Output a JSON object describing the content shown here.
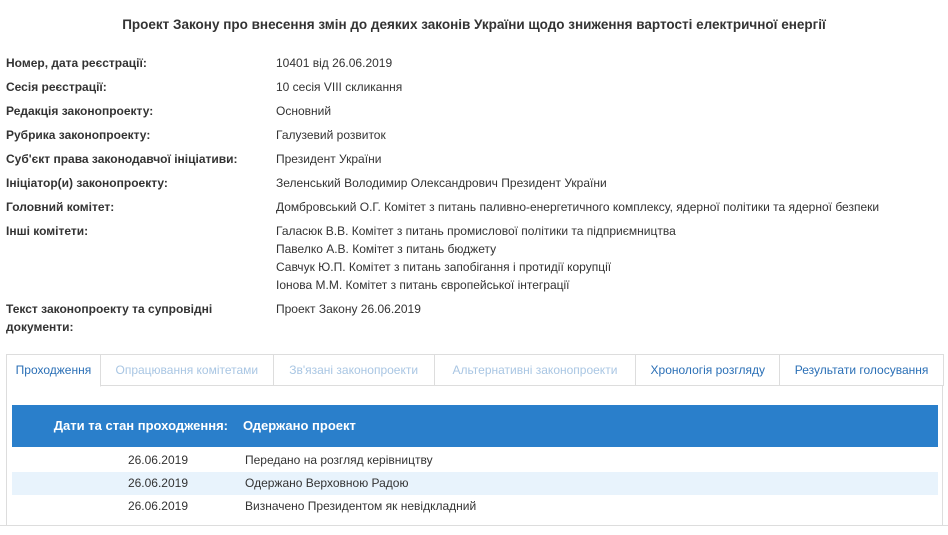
{
  "title": "Проект Закону про внесення змін до деяких законів України щодо зниження вартості електричної енергії",
  "fields": [
    {
      "label": "Номер, дата реєстрації:",
      "value": "10401 від 26.06.2019"
    },
    {
      "label": "Сесія реєстрації:",
      "value": "10 сесія VIII скликання"
    },
    {
      "label": "Редакція законопроекту:",
      "value": "Основний"
    },
    {
      "label": "Рубрика законопроекту:",
      "value": "Галузевий розвиток"
    },
    {
      "label": "Суб'єкт права законодавчої ініціативи:",
      "value": "Президент України"
    },
    {
      "label": "Ініціатор(и) законопроекту:",
      "value": "Зеленський Володимир Олександрович Президент України"
    },
    {
      "label": "Головний комітет:",
      "value": "Домбровський О.Г. Комітет з питань паливно-енергетичного комплексу, ядерної політики та ядерної безпеки"
    },
    {
      "label": "Інші комітети:",
      "values": [
        "Галасюк В.В. Комітет з питань промислової політики та підприємництва",
        "Павелко А.В. Комітет з питань бюджету",
        "Савчук Ю.П. Комітет з питань запобігання і протидії корупції",
        "Іонова М.М. Комітет з питань європейської інтеграції"
      ]
    },
    {
      "label_line1": "Текст законопроекту та супровідні",
      "label_line2": "документи:",
      "value": "Проект Закону 26.06.2019"
    }
  ],
  "tabs": [
    {
      "label": "Проходження",
      "state": "active"
    },
    {
      "label": "Опрацювання комітетами",
      "state": "disabled"
    },
    {
      "label": "Зв'язані законопроекти",
      "state": "disabled"
    },
    {
      "label": "Альтернативні законопроекти",
      "state": "disabled"
    },
    {
      "label": "Хронологія розгляду",
      "state": "enabled"
    },
    {
      "label": "Результати голосування",
      "state": "enabled"
    }
  ],
  "table": {
    "header_dates": "Дати та стан проходження:",
    "header_status": "Одержано проект",
    "rows": [
      {
        "date": "26.06.2019",
        "event": "Передано на розгляд керівництву"
      },
      {
        "date": "26.06.2019",
        "event": "Одержано Верховною Радою"
      },
      {
        "date": "26.06.2019",
        "event": "Визначено Президентом як невідкладний"
      }
    ]
  },
  "colors": {
    "accent": "#2a7fcb",
    "link": "#2a6fb6",
    "disabled_tab": "#a9c6e3",
    "alt_row": "#e8f3fc"
  }
}
